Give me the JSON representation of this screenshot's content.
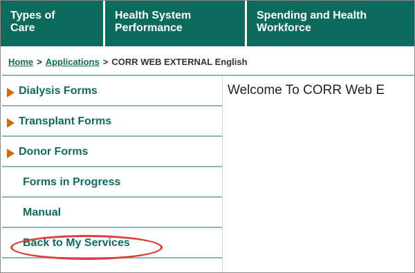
{
  "topnav": {
    "tabs": [
      {
        "line1": "Types of",
        "line2": "Care"
      },
      {
        "line1": "Health System",
        "line2": "Performance"
      },
      {
        "line1": "Spending and Health",
        "line2": "Workforce"
      }
    ]
  },
  "breadcrumb": {
    "home": "Home",
    "applications": "Applications",
    "separator": ">",
    "current": "CORR WEB EXTERNAL English"
  },
  "sidebar": {
    "items": [
      {
        "label": "Dialysis Forms"
      },
      {
        "label": "Transplant Forms"
      },
      {
        "label": "Donor Forms"
      },
      {
        "label": "Forms in Progress"
      },
      {
        "label": "Manual"
      },
      {
        "label": "Back to My Services"
      }
    ]
  },
  "main": {
    "welcome": "Welcome To CORR Web E"
  },
  "colors": {
    "nav_green": "#0c6b5d",
    "link_green": "#0c6b5d",
    "arrow_orange": "#cc6a18",
    "divider": "#8db6ad",
    "highlight_red": "#e03a36"
  }
}
